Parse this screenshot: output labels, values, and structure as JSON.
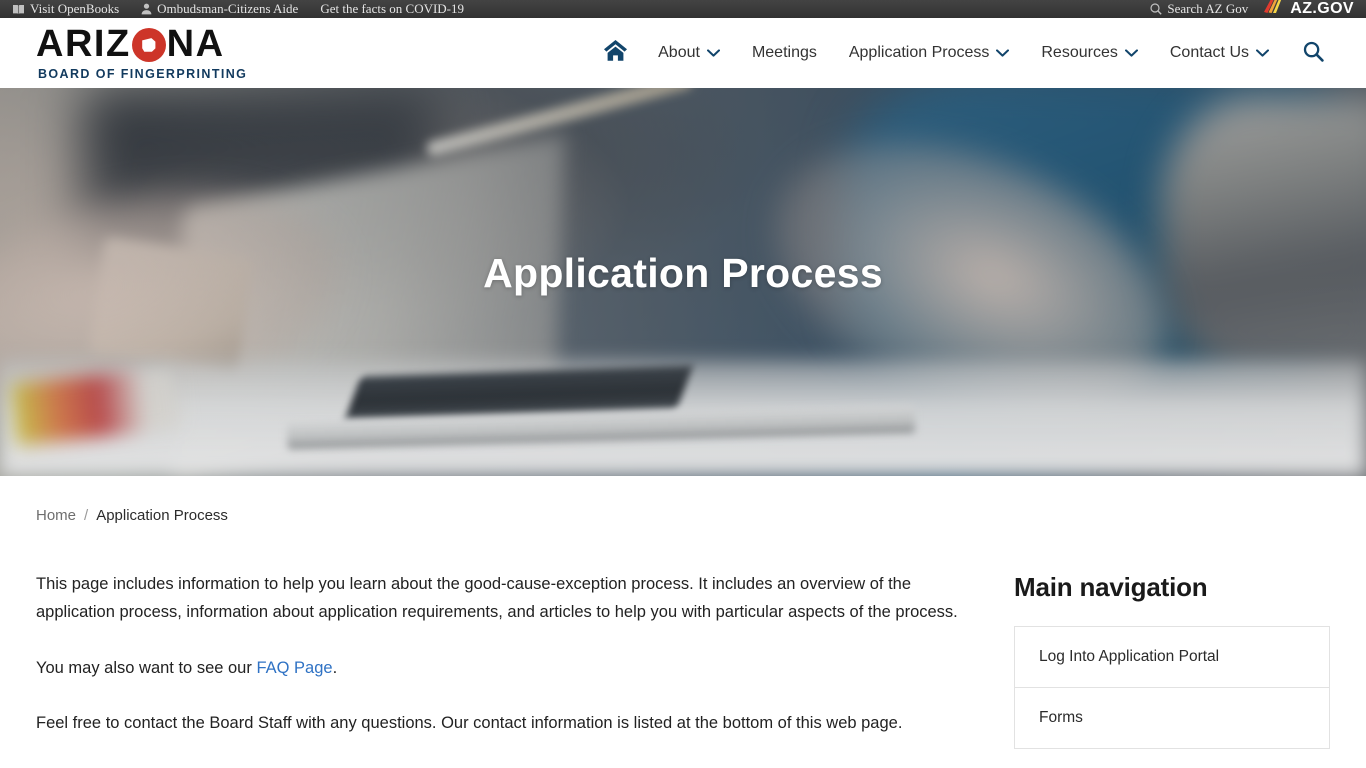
{
  "topbar": {
    "left_links": [
      {
        "label": "Visit OpenBooks",
        "icon": "book-icon"
      },
      {
        "label": "Ombudsman-Citizens Aide",
        "icon": "person-icon"
      },
      {
        "label": "Get the facts on COVID-19",
        "icon": "none"
      }
    ],
    "search_label": "Search AZ Gov",
    "search_icon": "search-icon",
    "azgov_wordmark": "AZ.GOV"
  },
  "brand": {
    "name_part1": "ARIZ",
    "name_part2": "NA",
    "subtitle": "BOARD OF FINGERPRINTING",
    "accent_color": "#cd3529",
    "subtitle_color": "#123a5e"
  },
  "nav": {
    "home_icon": "home-icon",
    "items": [
      {
        "label": "About",
        "has_dropdown": true
      },
      {
        "label": "Meetings",
        "has_dropdown": false
      },
      {
        "label": "Application Process",
        "has_dropdown": true
      },
      {
        "label": "Resources",
        "has_dropdown": true
      },
      {
        "label": "Contact Us",
        "has_dropdown": true
      }
    ],
    "search_icon": "search-icon"
  },
  "hero": {
    "title": "Application Process"
  },
  "breadcrumb": {
    "home": "Home",
    "separator": "/",
    "current": "Application Process"
  },
  "main": {
    "paragraph1": "This page includes information to help you learn about the good-cause-exception process. It includes an overview of the application process, information about application requirements, and articles to help you with particular aspects of the process.",
    "paragraph2_before": "You may also want to see our ",
    "paragraph2_link": "FAQ Page",
    "paragraph2_after": ".",
    "paragraph3": "Feel free to contact the Board Staff with any questions.  Our contact information is listed at the bottom of this web page."
  },
  "sidebar": {
    "heading": "Main navigation",
    "items": [
      {
        "label": "Log Into Application Portal"
      },
      {
        "label": "Forms"
      }
    ]
  }
}
